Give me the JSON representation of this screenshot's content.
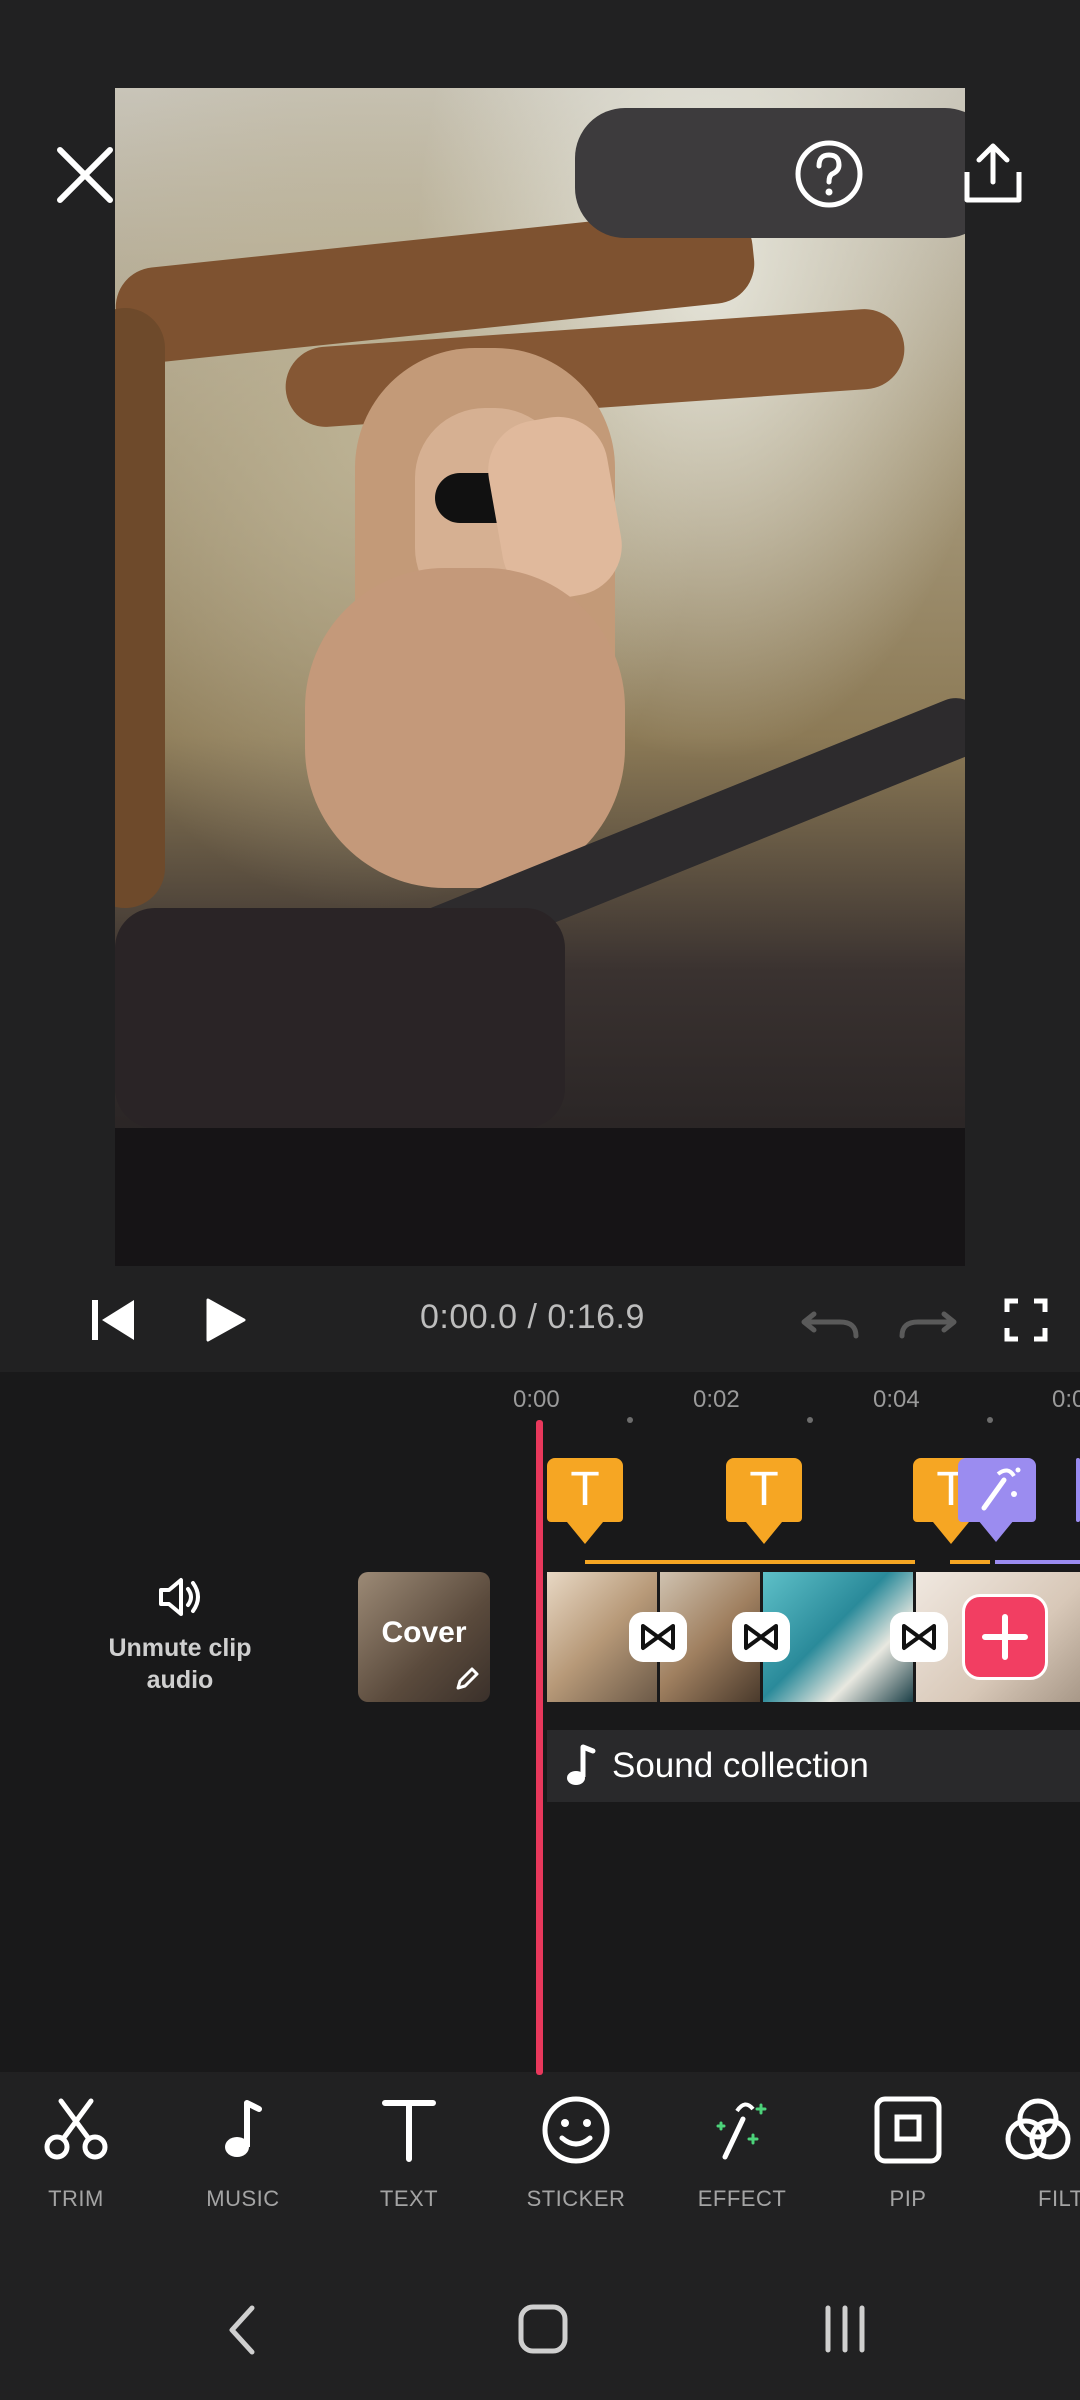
{
  "header": {
    "close_icon": "close-icon",
    "help_icon": "help-icon",
    "share_icon": "share-icon"
  },
  "player": {
    "time_display": "0:00.0 / 0:16.9"
  },
  "ruler": {
    "labels": [
      "0:00",
      "0:02",
      "0:04",
      "0:0"
    ]
  },
  "timeline": {
    "unmute_label": "Unmute clip audio",
    "cover_label": "Cover",
    "text_marker_glyph": "T",
    "sound_collection_label": "Sound collection"
  },
  "toolbar": {
    "items": [
      {
        "label": "TRIM",
        "icon": "scissors-icon"
      },
      {
        "label": "MUSIC",
        "icon": "music-note-icon"
      },
      {
        "label": "TEXT",
        "icon": "text-icon"
      },
      {
        "label": "STICKER",
        "icon": "smiley-icon"
      },
      {
        "label": "EFFECT",
        "icon": "magic-wand-icon"
      },
      {
        "label": "PIP",
        "icon": "pip-icon"
      },
      {
        "label": "FILT",
        "icon": "filter-icon"
      }
    ]
  },
  "colors": {
    "background": "#212122",
    "timeline_bg": "#19191a",
    "playhead": "#e8385c",
    "text_marker": "#f6a623",
    "effect_marker": "#9b8cf0",
    "add_button": "#f23e62"
  }
}
